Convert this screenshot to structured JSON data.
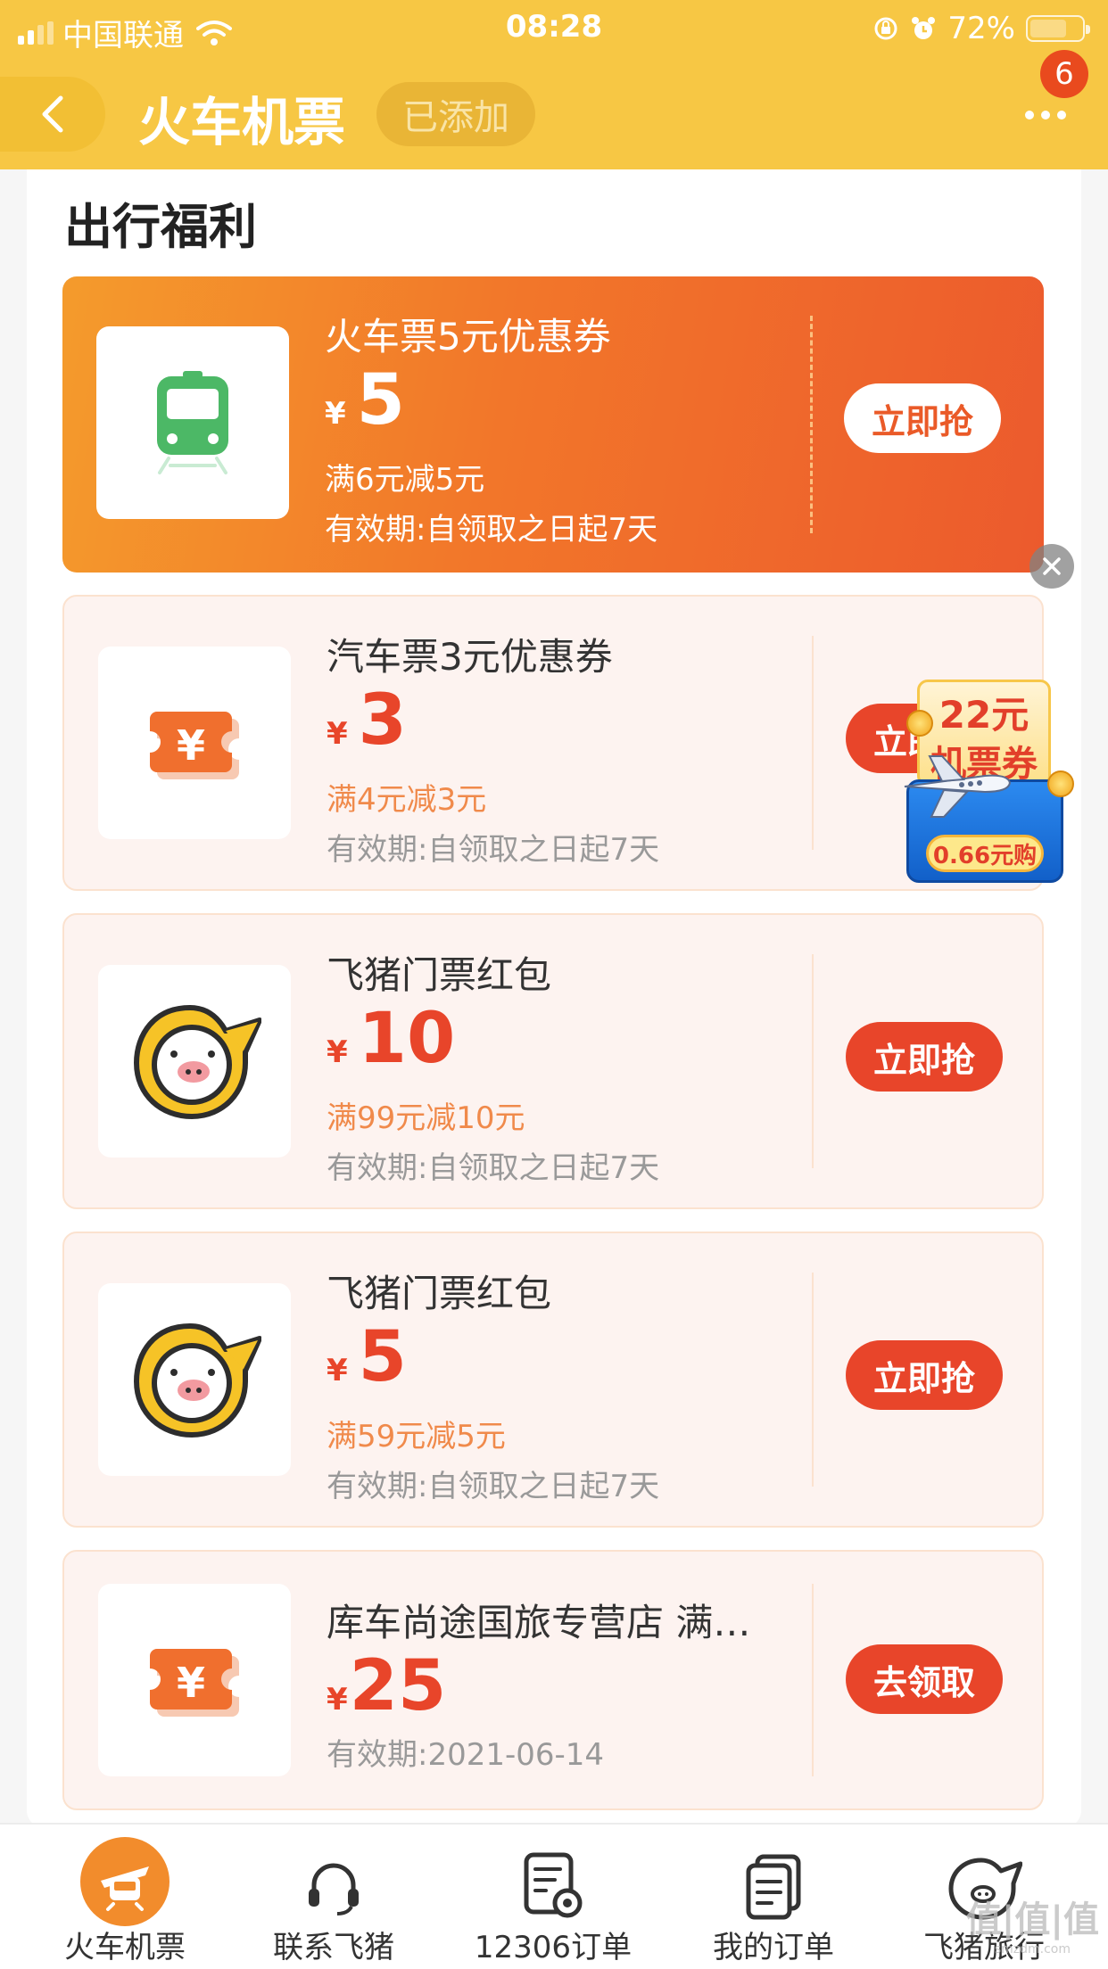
{
  "status_bar": {
    "carrier": "中国联通",
    "time": "08:28",
    "battery": "72%",
    "battery_level": 0.72
  },
  "nav": {
    "title": "火车机票",
    "added_label": "已添加",
    "badge_count": "6"
  },
  "section": {
    "title": "出行福利"
  },
  "coupons": [
    {
      "name": "火车票5元优惠券",
      "currency": "¥",
      "amount": "5",
      "condition": "满6元减5元",
      "validity": "有效期:自领取之日起7天",
      "action": "立即抢",
      "icon": "train-icon"
    },
    {
      "name": "汽车票3元优惠券",
      "currency": "¥",
      "amount": "3",
      "condition": "满4元减3元",
      "validity": "有效期:自领取之日起7天",
      "action": "立即抢",
      "icon": "ticket-yen-icon"
    },
    {
      "name": "飞猪门票红包",
      "currency": "¥",
      "amount": "10",
      "condition": "满99元减10元",
      "validity": "有效期:自领取之日起7天",
      "action": "立即抢",
      "icon": "fliggy-pig-icon"
    },
    {
      "name": "飞猪门票红包",
      "currency": "¥",
      "amount": "5",
      "condition": "满59元减5元",
      "validity": "有效期:自领取之日起7天",
      "action": "立即抢",
      "icon": "fliggy-pig-icon"
    },
    {
      "name": "库车尚途国旅专营店 满…",
      "currency": "¥",
      "amount": "25",
      "validity": "有效期:2021-06-14",
      "action": "去领取",
      "icon": "ticket-yen-icon"
    }
  ],
  "promo_float": {
    "line1": "22元",
    "line2": "机票券",
    "price": "0.66元购"
  },
  "tabbar": {
    "items": [
      {
        "label": "火车机票",
        "icon": "train-plane-icon",
        "active": true
      },
      {
        "label": "联系飞猪",
        "icon": "headset-icon",
        "active": false
      },
      {
        "label": "12306订单",
        "icon": "document-search-icon",
        "active": false
      },
      {
        "label": "我的订单",
        "icon": "orders-icon",
        "active": false
      },
      {
        "label": "飞猪旅行",
        "icon": "fliggy-pig-outline-icon",
        "active": false
      }
    ]
  },
  "watermark": {
    "text": "值|值|值",
    "sub": "smzdm.com"
  },
  "colors": {
    "header_yellow": "#f7c744",
    "accent_red": "#e8452a",
    "accent_orange": "#f28c2c"
  }
}
